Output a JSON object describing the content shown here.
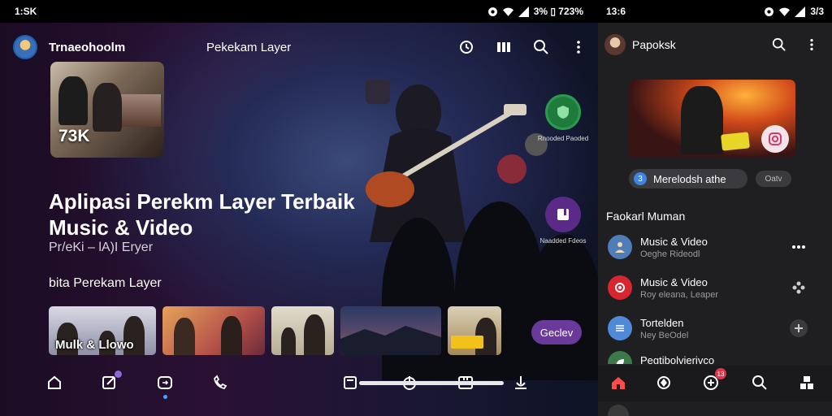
{
  "status_left": {
    "time": "1:SK"
  },
  "status_right_left_pane": {
    "battery_text": "3% ▯ 723%"
  },
  "status_right_pane": {
    "time": "13:6",
    "battery_text": "3/3"
  },
  "left": {
    "brand": "Trnaeohoolm",
    "page_title": "Pekekam Layer",
    "top_icons": [
      "history-icon",
      "columns-icon",
      "search-icon",
      "more-vertical-icon"
    ],
    "feature": {
      "count": "73K"
    },
    "headline_line1": "Aplipasi Perekm Layer Terbaik",
    "headline_line2": "Music & Video",
    "subline": "Pr/eKi – lA)I Eryer",
    "section_title": "bita Perekam Layer",
    "fab1_label": "Rnooded Paoded",
    "fab2_label": "Naadded Fdeos",
    "thumbnails": [
      {
        "caption": "Mulk & Llowo"
      },
      {
        "caption": ""
      },
      {
        "caption": ""
      },
      {
        "caption": ""
      },
      {
        "caption": ""
      }
    ],
    "pill_button": "Geclev",
    "bottom_nav": [
      "home-icon",
      "edit-icon",
      "sync-icon",
      "call-icon",
      "square-icon",
      "power-icon",
      "tablet-icon",
      "mic-icon"
    ]
  },
  "right": {
    "brand": "Papoksk",
    "chip_number": "3",
    "chip_label": "Merelodsh athe",
    "chip2_label": "Oatv",
    "section_title": "Faokarl Muman",
    "items": [
      {
        "title": "Music & Video",
        "subtitle": "Oeghe Rideodl",
        "icon": "person-icon",
        "trail": "more-horizontal-icon",
        "icon_color": "#4f7db8"
      },
      {
        "title": "Music & Video",
        "subtitle": "Roy eleana, Leaper",
        "icon": "record-icon",
        "trail": "gamepad-icon",
        "icon_color": "#d7262f"
      },
      {
        "title": "Tortelden",
        "subtitle": "Ney BeOdel",
        "icon": "list-icon",
        "trail": "plus-icon",
        "icon_color": "#4f8ad8"
      },
      {
        "title": "Pegtibolvierivco",
        "subtitle": "",
        "icon": "leaf-icon",
        "trail": "more-icon",
        "icon_color": "#3c7a4a"
      }
    ],
    "nav_badge": "13",
    "bottom_nav": [
      "home-icon",
      "shield-icon",
      "add-circle-icon",
      "search-icon",
      "grid-icon"
    ]
  },
  "colors": {
    "accent_purple": "#6a3a9a",
    "accent_green": "#1e7b3b",
    "home_red": "#ff4a4a"
  }
}
